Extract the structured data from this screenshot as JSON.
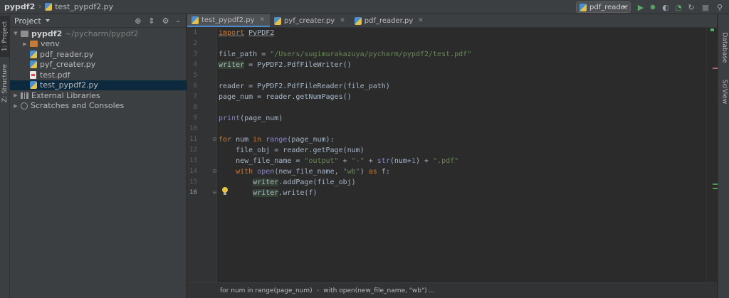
{
  "navbar": {
    "project": "pypdf2",
    "file": "test_pypdf2.py",
    "run_config": "pdf_reader"
  },
  "left_strip": {
    "project_tab": "1: Project",
    "structure_tab": "Z: Structure"
  },
  "right_strip": {
    "database_tab": "Database",
    "sciview_tab": "SciView"
  },
  "project_panel": {
    "title": "Project",
    "root_name": "pypdf2",
    "root_path": "~/pycharm/pypdf2",
    "items": [
      {
        "label": "venv",
        "kind": "folder"
      },
      {
        "label": "pdf_reader.py",
        "kind": "py"
      },
      {
        "label": "pyf_creater.py",
        "kind": "py"
      },
      {
        "label": "test.pdf",
        "kind": "pdf"
      },
      {
        "label": "test_pypdf2.py",
        "kind": "py"
      }
    ],
    "external_libraries": "External Libraries",
    "scratches": "Scratches and Consoles"
  },
  "tabs": [
    {
      "label": "test_pypdf2.py",
      "active": true
    },
    {
      "label": "pyf_creater.py",
      "active": false
    },
    {
      "label": "pdf_reader.py",
      "active": false
    }
  ],
  "editor": {
    "current_line": 16,
    "line_numbers": [
      "1",
      "2",
      "3",
      "4",
      "5",
      "6",
      "7",
      "8",
      "9",
      "10",
      "11",
      "12",
      "13",
      "14",
      "15",
      "16"
    ],
    "lines": [
      "import PyPDF2",
      "",
      "file_path = \"/Users/sugimurakazuya/pycharm/pypdf2/test.pdf\"",
      "writer = PyPDF2.PdfFileWriter()",
      "",
      "reader = PyPDF2.PdfFileReader(file_path)",
      "page_num = reader.getNumPages()",
      "",
      "print(page_num)",
      "",
      "for num in range(page_num):",
      "    file_obj = reader.getPage(num)",
      "    new_file_name = \"output\" + \"-\" + str(num+1) + \".pdf\"",
      "    with open(new_file_name, \"wb\") as f:",
      "        writer.addPage(file_obj)",
      "        writer.write(f)"
    ]
  },
  "breadcrumbs": [
    "for num in range(page_num)",
    "with open(new_file_name, \"wb\") ..."
  ],
  "colors": {
    "keyword": "#cc7832",
    "string": "#6a8759",
    "number": "#6897bb",
    "builtin": "#8888c6",
    "default": "#a9b7c6"
  }
}
